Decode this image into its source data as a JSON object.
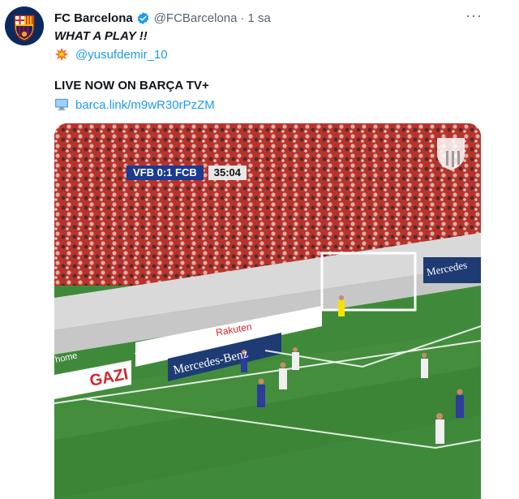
{
  "tweet": {
    "author_name": "FC Barcelona",
    "handle": "@FCBarcelona",
    "separator": "·",
    "time": "1 sa",
    "more_label": "···",
    "text_line1": "WHAT A PLAY !!",
    "mention": "@yusufdemir_10",
    "text_line3": "LIVE NOW ON BARÇA TV+",
    "link": "barca.link/m9wR30rPzZM"
  },
  "video": {
    "scoreboard_teams": "VFB 0:1 FCB",
    "scoreboard_clock": "35:04",
    "ads": {
      "gazi": "GAZI",
      "mercedes": "Mercedes-Benz",
      "mercedes_short": "Mercedes",
      "rakuten": "Rakuten",
      "cinema": "Your cinema at home",
      "home": "home"
    }
  },
  "colors": {
    "accent": "#1d9bf0",
    "verified": "#1d9bf0",
    "pitch": "#3f8a3a",
    "stands": "#b8332c"
  },
  "icons": {
    "verified": "verified-badge-icon",
    "mention_emoji": "explosion-icon",
    "link_emoji": "computer-icon",
    "more": "more-icon"
  }
}
